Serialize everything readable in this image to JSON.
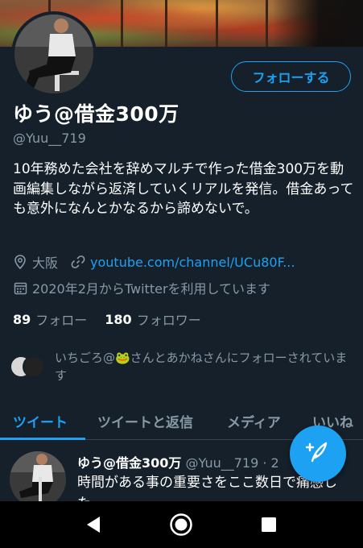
{
  "profile": {
    "follow_button": "フォローする",
    "display_name": "ゆう@借金300万",
    "handle": "@Yuu__719",
    "bio": "10年務めた会社を辞めマルチで作った借金300万を動画編集しながら返済していくリアルを発信。借金あっても意外になんとかなるから諦めないで。",
    "location": "大阪",
    "website": "youtube.com/channel/UCu80F...",
    "joined": "2020年2月からTwitterを利用しています",
    "following_count": "89",
    "following_label": "フォロー",
    "followers_count": "180",
    "followers_label": "フォロワー",
    "followed_by_text": "いちごろ@🐸さんとあかねさんにフォローされています"
  },
  "tabs": [
    "ツイート",
    "ツイートと返信",
    "メディア",
    "いいね"
  ],
  "active_tab": "ツイート",
  "tweet": {
    "name": "ゆう@借金300万",
    "handle": "@Yuu__719 · 2",
    "text": "時間がある事の重要さをここ数日で痛感した。"
  },
  "icons": {
    "location": "location-pin-icon",
    "link": "link-icon",
    "calendar": "calendar-icon",
    "compose": "compose-tweet-icon",
    "nav_back": "back-triangle-icon",
    "nav_home": "home-circle-icon",
    "nav_recents": "recents-square-icon"
  },
  "colors": {
    "background": "#15202b",
    "accent": "#1da1f2",
    "secondary_text": "#8899a6",
    "primary_text": "#ffffff"
  }
}
